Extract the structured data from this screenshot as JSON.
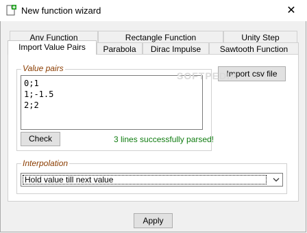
{
  "window": {
    "title": "New function wizard",
    "close_symbol": "✕"
  },
  "tabs": {
    "row_back": [
      {
        "label": "Anv Function"
      },
      {
        "label": "Rectangle Function"
      },
      {
        "label": "Unity Step"
      }
    ],
    "row_front": [
      {
        "label": "Import Value Pairs",
        "active": true
      },
      {
        "label": "Parabola"
      },
      {
        "label": "Dirac Impulse"
      },
      {
        "label": "Sawtooth Function"
      }
    ]
  },
  "value_pairs": {
    "legend": "Value pairs",
    "lines": [
      "0;1",
      "1;-1.5",
      "2;2"
    ],
    "check_label": "Check",
    "status": "3 lines successfully parsed!",
    "import_label": "Import csv file"
  },
  "interpolation": {
    "legend": "Interpolation",
    "selected": "Hold value till next value"
  },
  "footer": {
    "apply_label": "Apply"
  },
  "watermark": "SOFTPEDIA",
  "colors": {
    "legend_text": "#8a3c00",
    "status_text": "#0f7c10",
    "app_icon_plus": "#2aa52a"
  },
  "icons": {
    "app": "document-plus-icon",
    "close": "close-icon",
    "dropdown": "chevron-down-icon"
  }
}
